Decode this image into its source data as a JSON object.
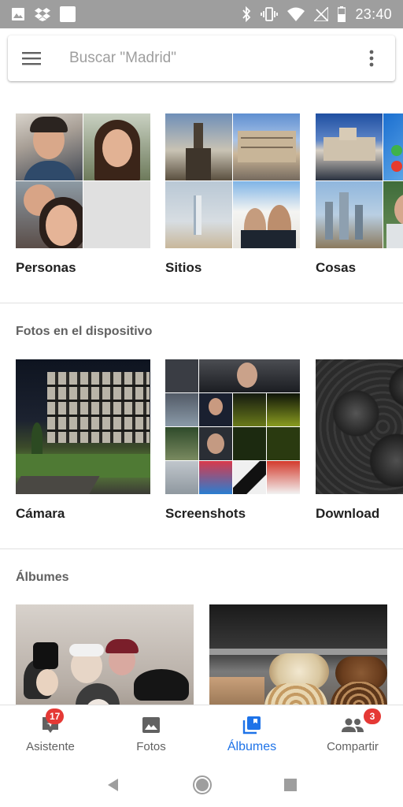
{
  "status_bar": {
    "time": "23:40",
    "left_icons": [
      "image-icon",
      "dropbox-icon",
      "blank-square-icon"
    ],
    "right_icons": [
      "bluetooth-icon",
      "vibrate-icon",
      "wifi-icon",
      "no-signal-icon",
      "battery-icon"
    ]
  },
  "search": {
    "placeholder": "Buscar \"Madrid\""
  },
  "explore": {
    "cards": [
      {
        "label": "Personas"
      },
      {
        "label": "Sitios"
      },
      {
        "label": "Cosas"
      }
    ]
  },
  "device": {
    "title": "Fotos en el dispositivo",
    "cards": [
      {
        "label": "Cámara"
      },
      {
        "label": "Screenshots"
      },
      {
        "label": "Download"
      }
    ]
  },
  "albums": {
    "title": "Álbumes"
  },
  "bottom_nav": {
    "items": [
      {
        "label": "Asistente",
        "badge": "17",
        "icon": "assistant-icon"
      },
      {
        "label": "Fotos",
        "icon": "photo-icon"
      },
      {
        "label": "Álbumes",
        "icon": "albums-icon",
        "active": true
      },
      {
        "label": "Compartir",
        "badge": "3",
        "icon": "people-icon"
      }
    ]
  },
  "colors": {
    "accent": "#1e73e8",
    "badge": "#e53935",
    "status_bar": "#9e9e9e"
  }
}
